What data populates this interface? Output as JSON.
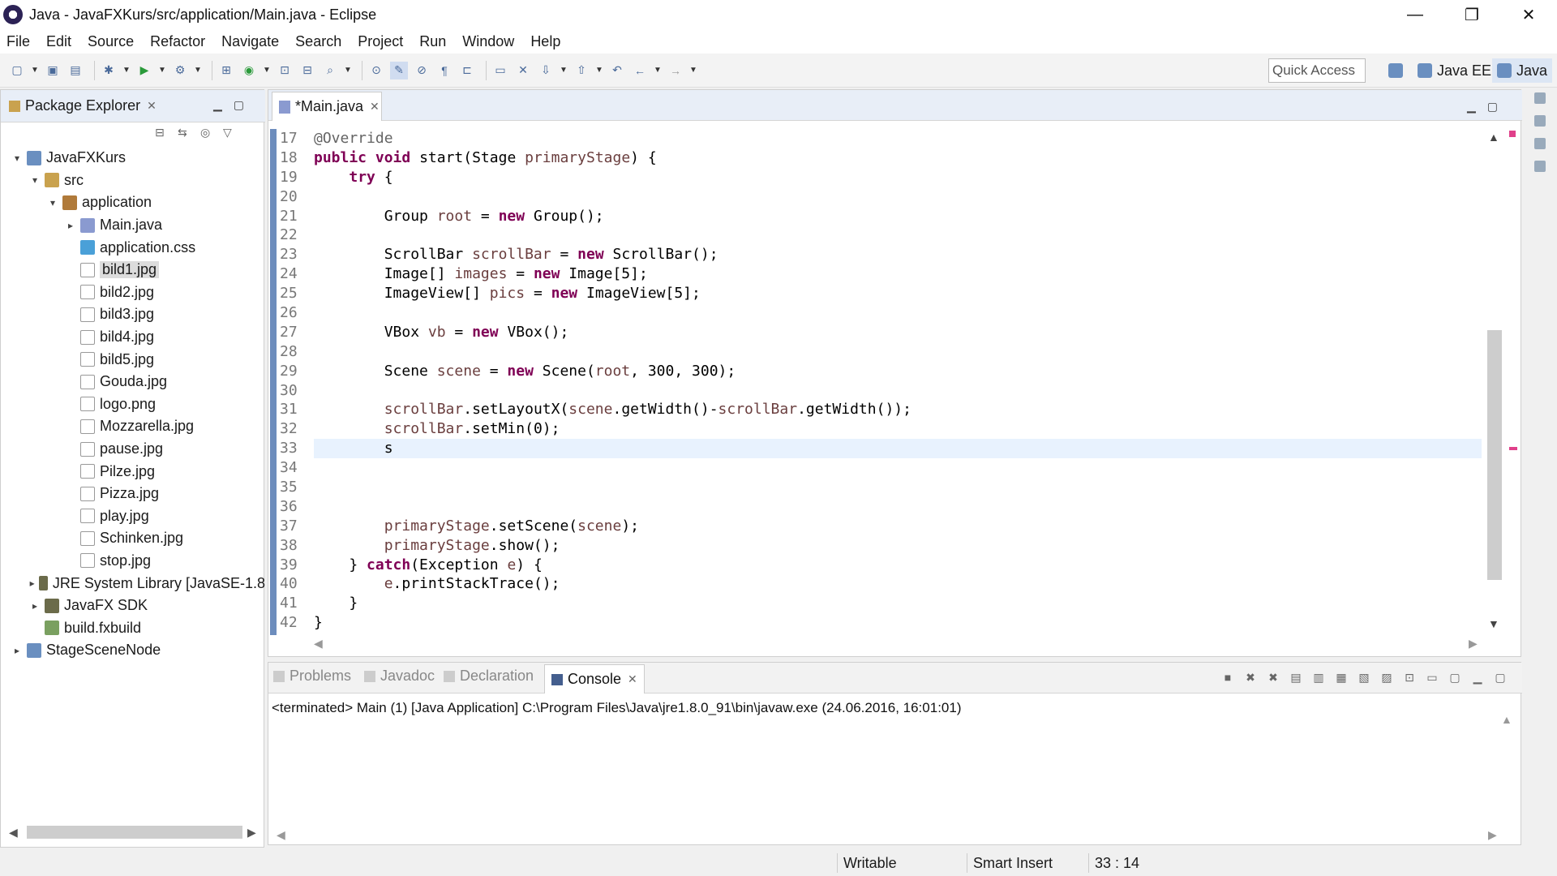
{
  "window": {
    "title": "Java - JavaFXKurs/src/application/Main.java - Eclipse",
    "minimize": "—",
    "maximize": "❐",
    "close": "✕"
  },
  "menu": [
    "File",
    "Edit",
    "Source",
    "Refactor",
    "Navigate",
    "Search",
    "Project",
    "Run",
    "Window",
    "Help"
  ],
  "toolbar": {
    "quick_access_placeholder": "Quick Access",
    "perspectives": [
      "Java EE",
      "Java"
    ]
  },
  "package_explorer": {
    "title": "Package Explorer",
    "tree": [
      {
        "label": "JavaFXKurs",
        "level": 0,
        "twisty": "v",
        "icon": "project-icon"
      },
      {
        "label": "src",
        "level": 1,
        "twisty": "v",
        "icon": "source-folder-icon"
      },
      {
        "label": "application",
        "level": 2,
        "twisty": "v",
        "icon": "package-icon"
      },
      {
        "label": "Main.java",
        "level": 3,
        "twisty": ">",
        "icon": "java-file-icon"
      },
      {
        "label": "application.css",
        "level": 3,
        "twisty": "",
        "icon": "css-file-icon"
      },
      {
        "label": "bild1.jpg",
        "level": 3,
        "twisty": "",
        "icon": "file-icon",
        "selected": true
      },
      {
        "label": "bild2.jpg",
        "level": 3,
        "twisty": "",
        "icon": "file-icon"
      },
      {
        "label": "bild3.jpg",
        "level": 3,
        "twisty": "",
        "icon": "file-icon"
      },
      {
        "label": "bild4.jpg",
        "level": 3,
        "twisty": "",
        "icon": "file-icon"
      },
      {
        "label": "bild5.jpg",
        "level": 3,
        "twisty": "",
        "icon": "file-icon"
      },
      {
        "label": "Gouda.jpg",
        "level": 3,
        "twisty": "",
        "icon": "file-icon"
      },
      {
        "label": "logo.png",
        "level": 3,
        "twisty": "",
        "icon": "file-icon"
      },
      {
        "label": "Mozzarella.jpg",
        "level": 3,
        "twisty": "",
        "icon": "file-icon"
      },
      {
        "label": "pause.jpg",
        "level": 3,
        "twisty": "",
        "icon": "file-icon"
      },
      {
        "label": "Pilze.jpg",
        "level": 3,
        "twisty": "",
        "icon": "file-icon"
      },
      {
        "label": "Pizza.jpg",
        "level": 3,
        "twisty": "",
        "icon": "file-icon"
      },
      {
        "label": "play.jpg",
        "level": 3,
        "twisty": "",
        "icon": "file-icon"
      },
      {
        "label": "Schinken.jpg",
        "level": 3,
        "twisty": "",
        "icon": "file-icon"
      },
      {
        "label": "stop.jpg",
        "level": 3,
        "twisty": "",
        "icon": "file-icon"
      },
      {
        "label": "JRE System Library [JavaSE-1.8",
        "level": 1,
        "twisty": ">",
        "icon": "library-icon"
      },
      {
        "label": "JavaFX SDK",
        "level": 1,
        "twisty": ">",
        "icon": "library-icon"
      },
      {
        "label": "build.fxbuild",
        "level": 1,
        "twisty": "",
        "icon": "fxbuild-file-icon"
      },
      {
        "label": "StageSceneNode",
        "level": 0,
        "twisty": ">",
        "icon": "project-icon"
      }
    ]
  },
  "editor": {
    "tab_label": "*Main.java",
    "lines": [
      {
        "n": "17",
        "html": "<span class=\"ann\">@Override</span>"
      },
      {
        "n": "18",
        "html": "<span class=\"kw\">public</span> <span class=\"kw\">void</span> start(Stage <span class=\"var\">primaryStage</span>) {"
      },
      {
        "n": "19",
        "html": "    <span class=\"kw\">try</span> {"
      },
      {
        "n": "20",
        "html": ""
      },
      {
        "n": "21",
        "html": "        Group <span class=\"var\">root</span> = <span class=\"kw\">new</span> Group();"
      },
      {
        "n": "22",
        "html": ""
      },
      {
        "n": "23",
        "html": "        ScrollBar <span class=\"var\">scrollBar</span> = <span class=\"kw\">new</span> ScrollBar();"
      },
      {
        "n": "24",
        "html": "        Image[] <span class=\"var\">images</span> = <span class=\"kw\">new</span> Image[5];"
      },
      {
        "n": "25",
        "html": "        ImageView[] <span class=\"var\">pics</span> = <span class=\"kw\">new</span> ImageView[5];"
      },
      {
        "n": "26",
        "html": ""
      },
      {
        "n": "27",
        "html": "        VBox <span class=\"var\">vb</span> = <span class=\"kw\">new</span> VBox();"
      },
      {
        "n": "28",
        "html": ""
      },
      {
        "n": "29",
        "html": "        Scene <span class=\"var\">scene</span> = <span class=\"kw\">new</span> Scene(<span class=\"var\">root</span>, 300, 300);"
      },
      {
        "n": "30",
        "html": ""
      },
      {
        "n": "31",
        "html": "        <span class=\"var\">scrollBar</span>.setLayoutX(<span class=\"var\">scene</span>.getWidth()-<span class=\"var\">scrollBar</span>.getWidth());"
      },
      {
        "n": "32",
        "html": "        <span class=\"var\">scrollBar</span>.setMin(0);"
      },
      {
        "n": "33",
        "html": "        s",
        "current": true
      },
      {
        "n": "34",
        "html": ""
      },
      {
        "n": "35",
        "html": ""
      },
      {
        "n": "36",
        "html": ""
      },
      {
        "n": "37",
        "html": "        <span class=\"var\">primaryStage</span>.setScene(<span class=\"var\">scene</span>);"
      },
      {
        "n": "38",
        "html": "        <span class=\"var\">primaryStage</span>.show();"
      },
      {
        "n": "39",
        "html": "    } <span class=\"kw\">catch</span>(Exception <span class=\"var\">e</span>) {"
      },
      {
        "n": "40",
        "html": "        <span class=\"var\">e</span>.printStackTrace();"
      },
      {
        "n": "41",
        "html": "    }"
      },
      {
        "n": "42",
        "html": "}"
      }
    ]
  },
  "panel": {
    "tabs": [
      {
        "label": "Problems",
        "icon": "problems-icon"
      },
      {
        "label": "Javadoc",
        "icon": "javadoc-icon"
      },
      {
        "label": "Declaration",
        "icon": "declaration-icon"
      },
      {
        "label": "Console",
        "icon": "console-icon",
        "active": true
      }
    ],
    "console_text": "<terminated> Main (1) [Java Application] C:\\Program Files\\Java\\jre1.8.0_91\\bin\\javaw.exe (24.06.2016, 16:01:01)"
  },
  "status": {
    "writable": "Writable",
    "insert_mode": "Smart Insert",
    "position": "33 : 14"
  }
}
